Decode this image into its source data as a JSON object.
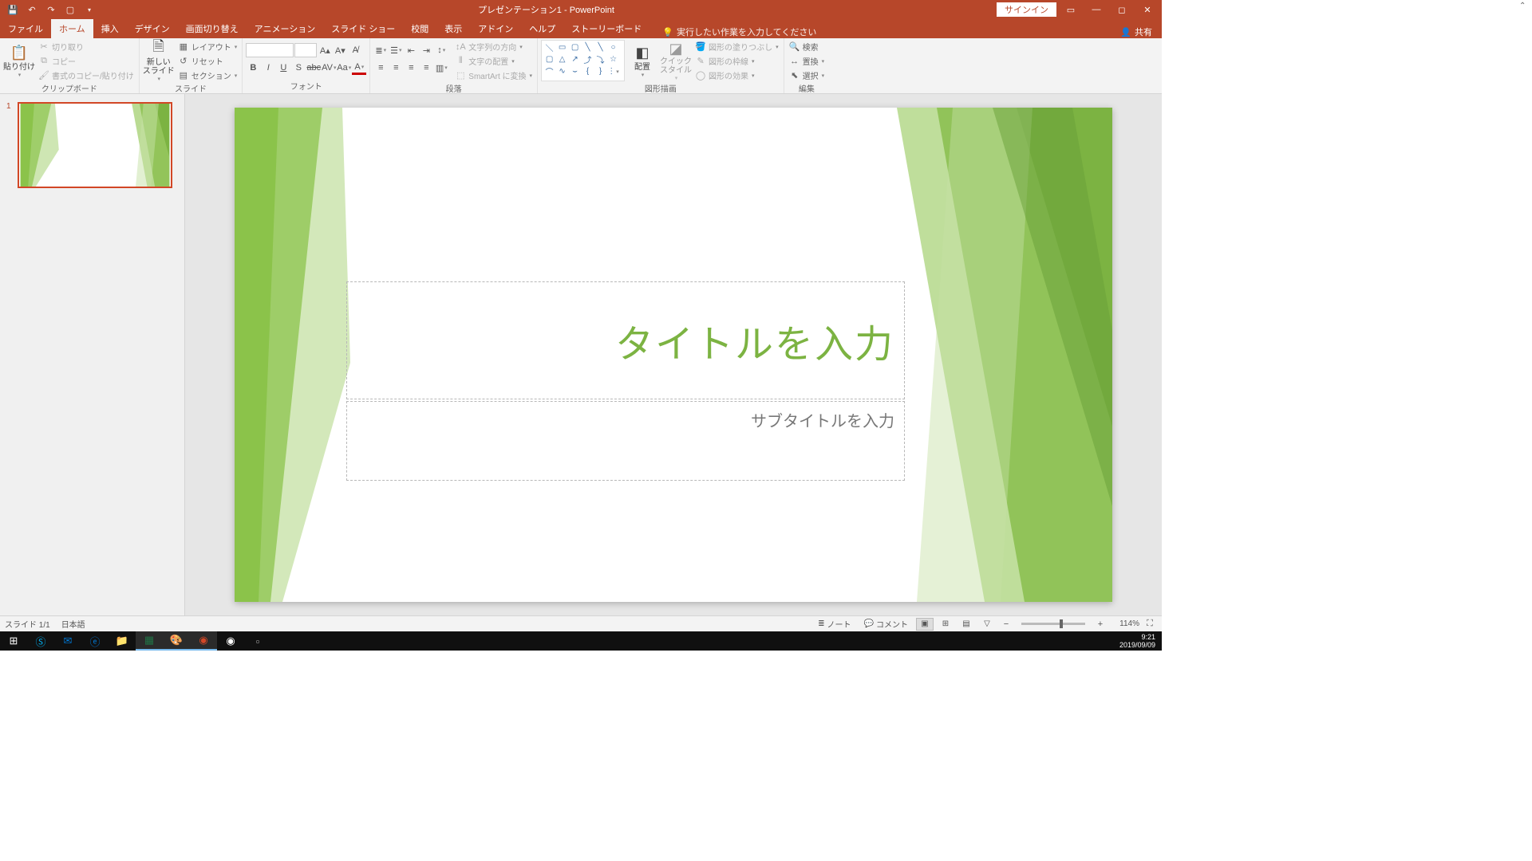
{
  "titlebar": {
    "title": "プレゼンテーション1 - PowerPoint",
    "signin": "サインイン"
  },
  "tabs": {
    "file": "ファイル",
    "home": "ホーム",
    "insert": "挿入",
    "design": "デザイン",
    "transitions": "画面切り替え",
    "animations": "アニメーション",
    "slideshow": "スライド ショー",
    "review": "校閲",
    "view": "表示",
    "addins": "アドイン",
    "help": "ヘルプ",
    "storyboard": "ストーリーボード",
    "tellme": "実行したい作業を入力してください",
    "share": "共有"
  },
  "ribbon": {
    "clipboard": {
      "label": "クリップボード",
      "paste": "貼り付け",
      "cut": "切り取り",
      "copy": "コピー",
      "format_painter": "書式のコピー/貼り付け"
    },
    "slides": {
      "label": "スライド",
      "new_slide": "新しい\nスライド",
      "layout": "レイアウト",
      "reset": "リセット",
      "section": "セクション"
    },
    "font": {
      "label": "フォント"
    },
    "paragraph": {
      "label": "段落",
      "text_direction": "文字列の方向",
      "align_text": "文字の配置",
      "smartart": "SmartArt に変換"
    },
    "drawing": {
      "label": "図形描画",
      "arrange": "配置",
      "quick_styles": "クイック\nスタイル",
      "shape_fill": "図形の塗りつぶし",
      "shape_outline": "図形の枠線",
      "shape_effects": "図形の効果"
    },
    "editing": {
      "label": "編集",
      "find": "検索",
      "replace": "置換",
      "select": "選択"
    }
  },
  "thumbs": {
    "slide1_num": "1"
  },
  "slide": {
    "title_placeholder": "タイトルを入力",
    "subtitle_placeholder": "サブタイトルを入力"
  },
  "statusbar": {
    "slide_info": "スライド 1/1",
    "language": "日本語",
    "notes": "ノート",
    "comments": "コメント",
    "zoom": "114%"
  },
  "taskbar": {
    "time": "9:21",
    "date": "2019/09/09"
  }
}
